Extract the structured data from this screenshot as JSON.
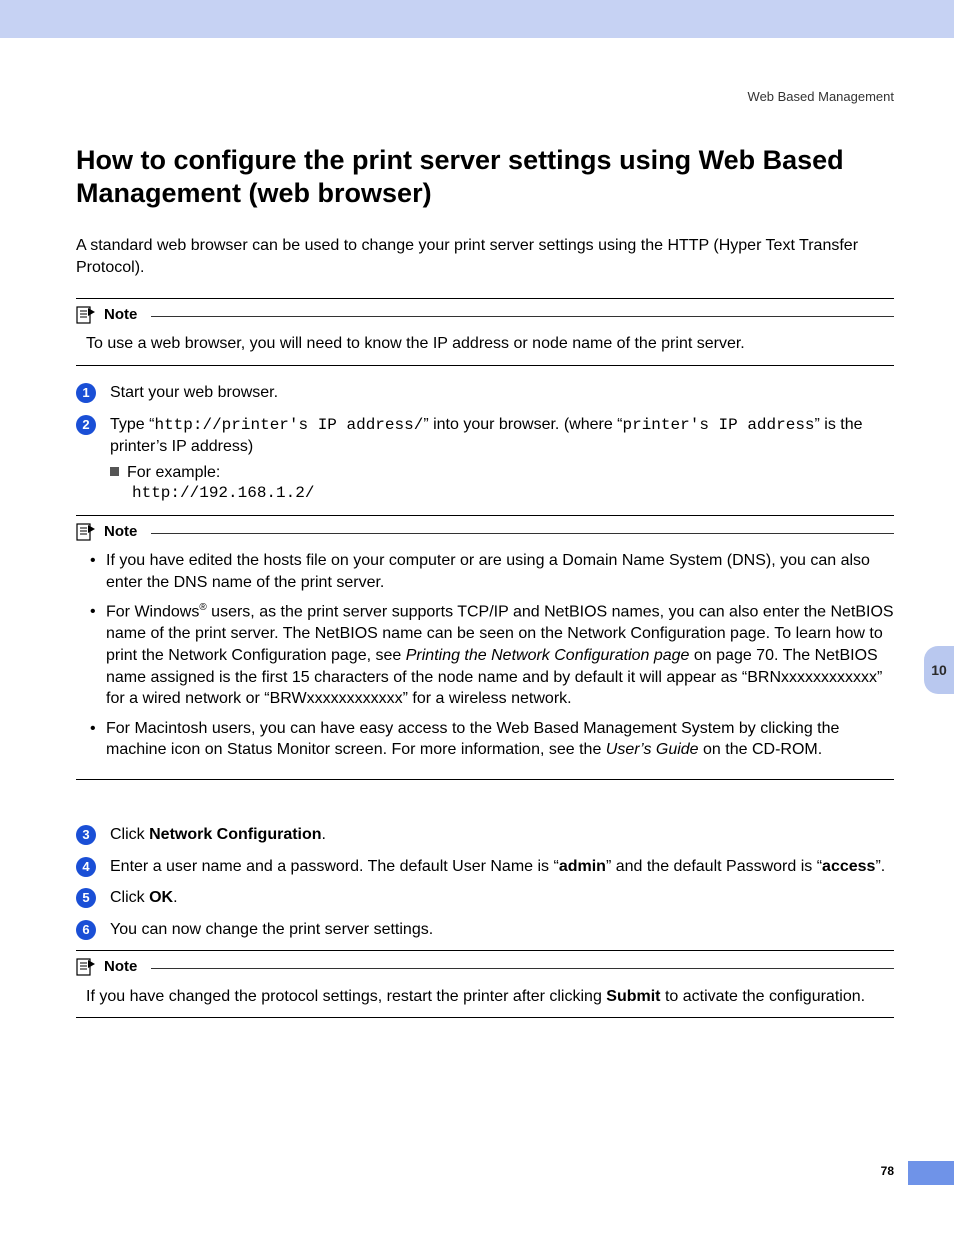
{
  "header": {
    "section": "Web Based Management"
  },
  "title": "How to configure the print server settings using Web Based Management (web browser)",
  "intro": "A standard web browser can be used to change your print server settings using the HTTP (Hyper Text Transfer Protocol).",
  "note_label": "Note",
  "note1": {
    "body": "To use a web browser, you will need to know the IP address or node name of the print server."
  },
  "steps": {
    "s1": "Start your web browser.",
    "s2": {
      "prefix": "Type “",
      "url1": "http://printer's IP address/",
      "mid": "” into your browser. (where “",
      "url2": "printer's IP address",
      "suffix": "” is the printer’s IP address)",
      "example_label": "For example:",
      "example_url": "http://192.168.1.2/"
    },
    "s3": {
      "prefix": "Click ",
      "bold": "Network Configuration",
      "suffix": "."
    },
    "s4": {
      "t1": "Enter a user name and a password. The default User Name is “",
      "b1": "admin",
      "t2": "” and the default Password is “",
      "b2": "access",
      "t3": "”."
    },
    "s5": {
      "prefix": "Click ",
      "bold": "OK",
      "suffix": "."
    },
    "s6": "You can now change the print server settings."
  },
  "note2": {
    "b1": "If you have edited the hosts file on your computer or are using a Domain Name System (DNS), you can also enter the DNS name of the print server.",
    "b2": {
      "t1": "For Windows",
      "sup": "®",
      "t2": " users, as the print server supports TCP/IP and NetBIOS names, you can also enter the NetBIOS name of the print server. The NetBIOS name can be seen on the Network Configuration page. To learn how to print the Network Configuration page, see ",
      "italic": "Printing the Network Configuration page",
      "t3": " on page 70. The NetBIOS name assigned is the first 15 characters of the node name and by default it will appear as “BRNxxxxxxxxxxxx” for a wired network or “BRWxxxxxxxxxxxx” for a wireless network."
    },
    "b3": {
      "t1": "For Macintosh users, you can have easy access to the Web Based Management System by clicking the machine icon on Status Monitor screen. For more information, see the ",
      "italic": "User’s Guide",
      "t2": " on the CD-ROM."
    }
  },
  "note3": {
    "t1": "If you have changed the protocol settings, restart the printer after clicking ",
    "bold": "Submit",
    "t2": " to activate the configuration."
  },
  "sidetab": "10",
  "pagenum": "78"
}
